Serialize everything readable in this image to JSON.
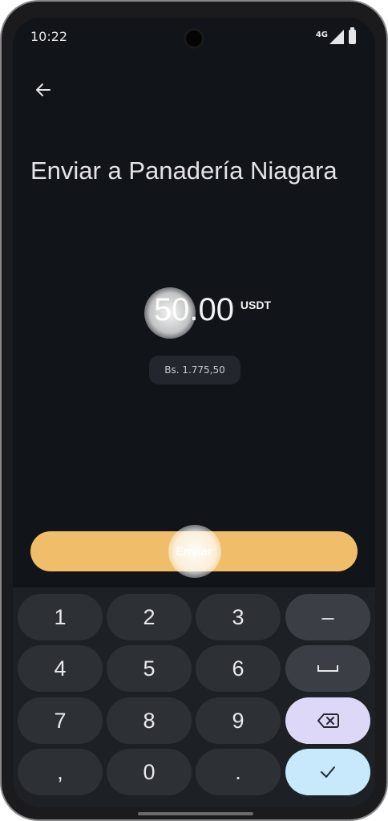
{
  "status": {
    "time": "10:22",
    "network": "4G"
  },
  "header": {
    "back_icon": "arrow-left-icon"
  },
  "title": "Enviar a Panadería Niagara",
  "amount": {
    "value": "50.00",
    "currency": "USDT"
  },
  "fiat_equivalent": "Bs. 1.775,50",
  "send_button": {
    "label": "Enviar",
    "color": "#f0be6a"
  },
  "keyboard": {
    "keys": [
      "1",
      "2",
      "3",
      "–",
      "4",
      "5",
      "6",
      "space",
      "7",
      "8",
      "9",
      "backspace",
      ",",
      "0",
      ".",
      "done"
    ],
    "row1": [
      "1",
      "2",
      "3",
      "–"
    ],
    "row2": [
      "4",
      "5",
      "6"
    ],
    "row3": [
      "7",
      "8",
      "9"
    ],
    "row4": [
      ",",
      "0",
      "."
    ],
    "confirm_icon": "checkmark-icon"
  }
}
